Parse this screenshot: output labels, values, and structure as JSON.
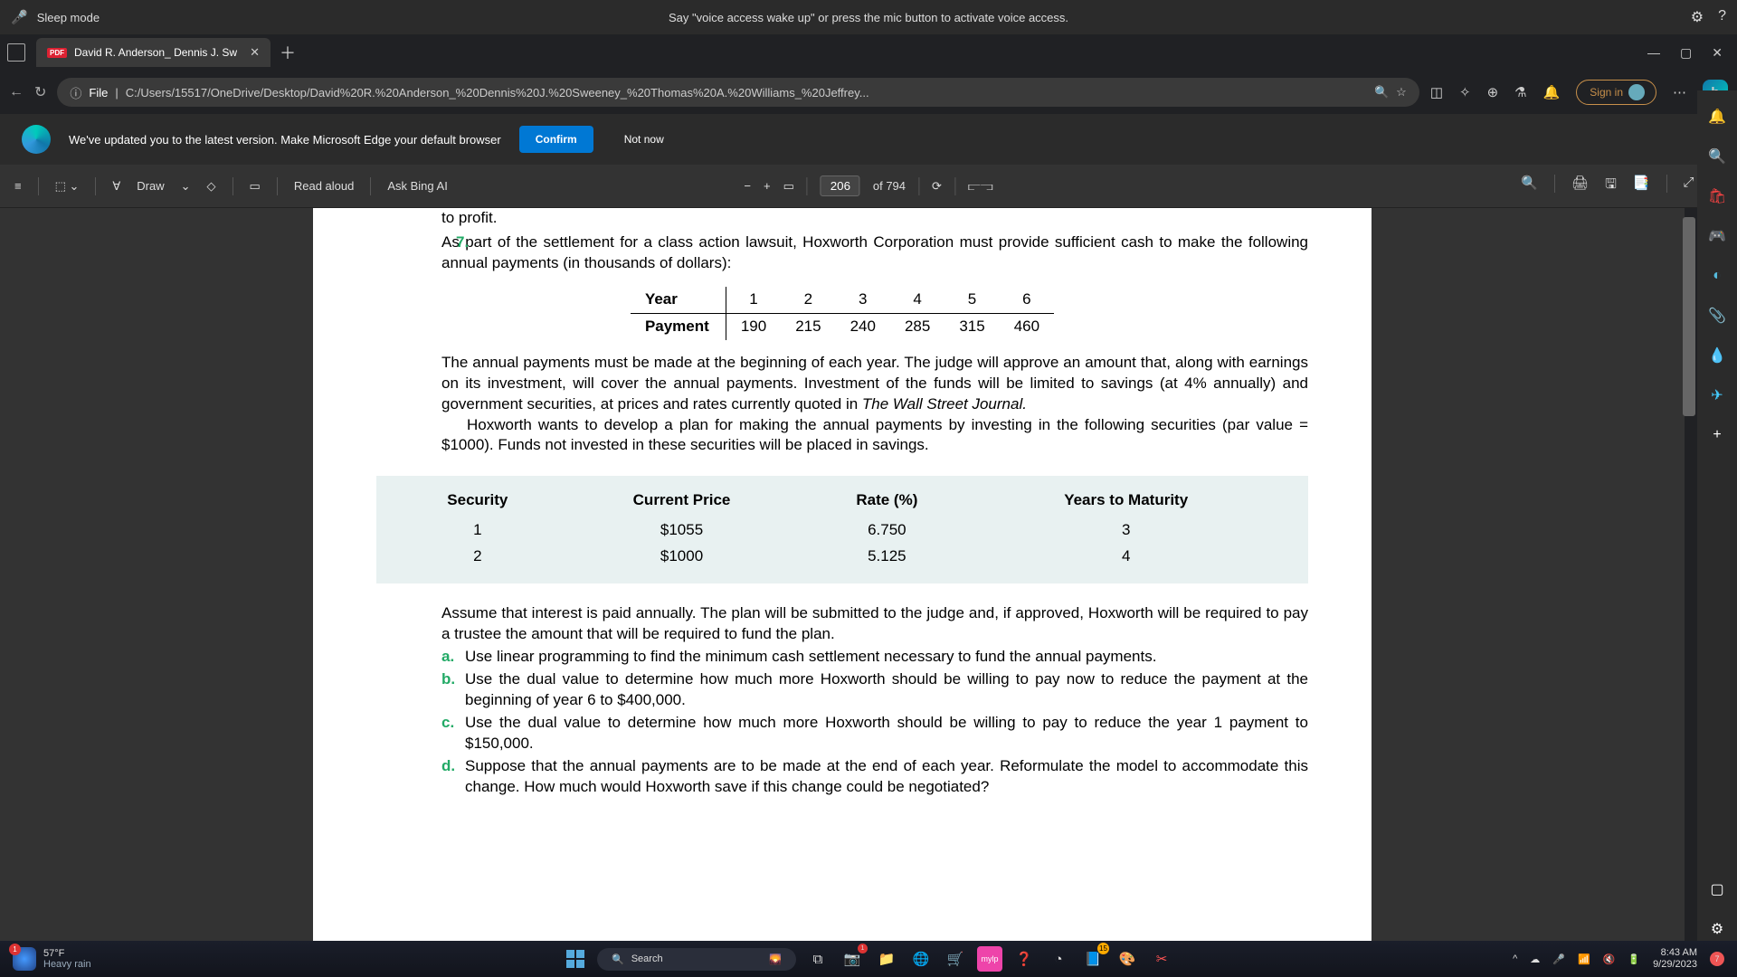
{
  "voice": {
    "mode": "Sleep mode",
    "hint": "Say \"voice access wake up\" or press the mic button to activate voice access."
  },
  "tab": {
    "title": "David R. Anderson_ Dennis J. Sw"
  },
  "url": {
    "scheme_label": "File",
    "path": "C:/Users/15517/OneDrive/Desktop/David%20R.%20Anderson_%20Dennis%20J.%20Sweeney_%20Thomas%20A.%20Williams_%20Jeffrey..."
  },
  "signin": "Sign in",
  "banner": {
    "text": "We've updated you to the latest version. Make Microsoft Edge your default browser",
    "confirm": "Confirm",
    "notnow": "Not now"
  },
  "pdfbar": {
    "draw": "Draw",
    "read": "Read aloud",
    "ask": "Ask Bing AI",
    "page": "206",
    "of": "of 794"
  },
  "doc": {
    "frag_top": "to profit.",
    "q_num": "7.",
    "q_text": "As part of the settlement for a class action lawsuit, Hoxworth Corporation must provide sufficient cash to make the following annual payments (in thousands of dollars):",
    "year_lbl": "Year",
    "pay_lbl": "Payment",
    "years": [
      "1",
      "2",
      "3",
      "4",
      "5",
      "6"
    ],
    "payments": [
      "190",
      "215",
      "240",
      "285",
      "315",
      "460"
    ],
    "para1": "The annual payments must be made at the beginning of each year. The judge will approve an amount that, along with earnings on its investment, will cover the annual payments. Investment of the funds will be limited to savings (at 4% annually) and government securities, at prices and rates currently quoted in ",
    "wsj": "The Wall Street Journal.",
    "para2": "Hoxworth wants to develop a plan for making the annual payments by investing in the following securities (par value = $1000). Funds not invested in these securities will be placed in savings.",
    "sec_h": [
      "Security",
      "Current Price",
      "Rate (%)",
      "Years to Maturity"
    ],
    "sec_r1": [
      "1",
      "$1055",
      "6.750",
      "3"
    ],
    "sec_r2": [
      "2",
      "$1000",
      "5.125",
      "4"
    ],
    "para3": "Assume that interest is paid annually. The plan will be submitted to the judge and, if approved, Hoxworth will be required to pay a trustee the amount that will be required to fund the plan.",
    "a": "Use linear programming to find the minimum cash settlement necessary to fund the annual payments.",
    "b": "Use the dual value to determine how much more Hoxworth should be willing to pay now to reduce the payment at the beginning of year 6 to $400,000.",
    "c": "Use the dual value to determine how much more Hoxworth should be willing to pay to reduce the year 1 payment to $150,000.",
    "d": "Suppose that the annual payments are to be made at the end of each year. Reformulate the model to accommodate this change. How much would Hoxworth save if this change could be negotiated?"
  },
  "taskbar": {
    "temp": "57°F",
    "cond": "Heavy rain",
    "search": "Search",
    "time": "8:43 AM",
    "date": "9/29/2023",
    "badge_w": "1",
    "badge_n": "7",
    "badge_app": "15"
  }
}
